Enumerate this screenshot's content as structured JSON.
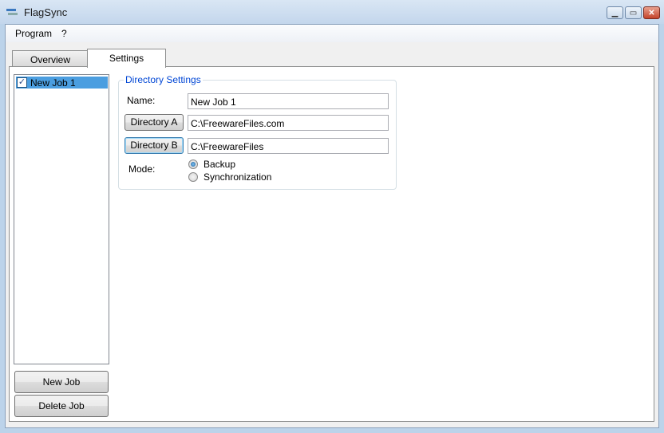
{
  "window": {
    "title": "FlagSync",
    "app_icon": "flag-sync-icon",
    "controls": [
      "minimize",
      "maximize",
      "close"
    ]
  },
  "menu": [
    "Program",
    "?"
  ],
  "tabs": [
    {
      "label": "Overview",
      "active": false
    },
    {
      "label": "Settings",
      "active": true
    }
  ],
  "jobs": [
    {
      "label": "New Job 1",
      "checked": true,
      "selected": true
    }
  ],
  "buttons": {
    "new_job": "New Job",
    "delete_job": "Delete Job"
  },
  "directory_settings": {
    "title": "Directory Settings",
    "name_label": "Name:",
    "name_value": "New Job 1",
    "dir_a_button": "Directory A",
    "dir_a_value": "C:\\FreewareFiles.com",
    "dir_b_button": "Directory B",
    "dir_b_value": "C:\\FreewareFiles",
    "mode_label": "Mode:",
    "modes": [
      {
        "label": "Backup",
        "selected": true
      },
      {
        "label": "Synchronization",
        "selected": false
      }
    ]
  }
}
